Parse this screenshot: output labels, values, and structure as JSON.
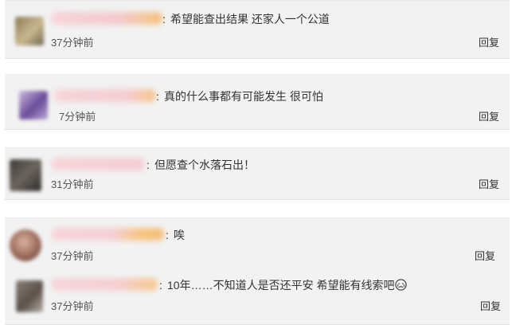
{
  "comments": [
    {
      "separator": ":",
      "text": "希望能查出结果 还家人一个公道",
      "time": "37分钟前",
      "reply": "回复"
    },
    {
      "separator": ":",
      "text": "真的什么事都有可能发生 很可怕",
      "time": "7分钟前",
      "reply": "回复"
    },
    {
      "separator": ":",
      "text": "但愿查个水落石出！",
      "time": "31分钟前",
      "reply": "回复"
    },
    {
      "separator": ":",
      "text": "唉",
      "time": "37分钟前",
      "reply": "回复"
    },
    {
      "separator": ":",
      "text": "10年……不知道人是否还平安  希望能有线索吧",
      "emoji": "crying-face-icon",
      "time": "37分钟前",
      "reply": "回复"
    }
  ],
  "colors": {
    "card_bg": "#f2f2f2",
    "text": "#333333",
    "time": "#555555",
    "name_blur_pink": "#f7cfd4",
    "name_blur_orange": "#f6c58a"
  }
}
